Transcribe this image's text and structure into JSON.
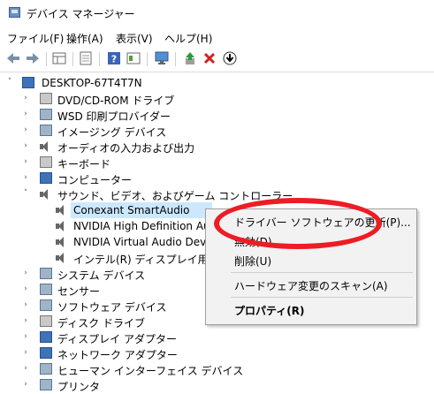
{
  "window": {
    "title": "デバイス マネージャー"
  },
  "menubar": {
    "items": [
      {
        "label": "ファイル(F)"
      },
      {
        "label": "操作(A)"
      },
      {
        "label": "表示(V)"
      },
      {
        "label": "ヘルプ(H)"
      }
    ]
  },
  "toolbar": {
    "buttons": [
      "back-icon",
      "forward-icon",
      "properties-grid-icon",
      "page-icon",
      "help-icon",
      "view-icon",
      "monitor-icon",
      "update-driver-icon",
      "uninstall-x-icon",
      "download-icon"
    ]
  },
  "tree": {
    "root": "DESKTOP-67T4T7N",
    "categories": [
      {
        "label": "DVD/CD-ROM ドライブ"
      },
      {
        "label": "WSD 印刷プロバイダー"
      },
      {
        "label": "イメージング デバイス"
      },
      {
        "label": "オーディオの入力および出力"
      },
      {
        "label": "キーボード"
      },
      {
        "label": "コンピューター"
      },
      {
        "label": "サウンド、ビデオ、およびゲーム コントローラー"
      },
      {
        "label": "システム デバイス"
      },
      {
        "label": "センサー"
      },
      {
        "label": "ソフトウェア デバイス"
      },
      {
        "label": "ディスク ドライブ"
      },
      {
        "label": "ディスプレイ アダプター"
      },
      {
        "label": "ネットワーク アダプター"
      },
      {
        "label": "ヒューマン インターフェイス デバイス"
      },
      {
        "label": "プリンタ"
      }
    ],
    "sound_children": [
      {
        "label": "Conexant SmartAudio"
      },
      {
        "label": "NVIDIA High Definition Aud"
      },
      {
        "label": "NVIDIA Virtual Audio Devic"
      },
      {
        "label": "インテル(R) ディスプレイ用オーデ"
      }
    ]
  },
  "context_menu": {
    "items": [
      {
        "label": "ドライバー ソフトウェアの更新(P)..."
      },
      {
        "label": "無効(D)"
      },
      {
        "label": "削除(U)"
      },
      {
        "label": "ハードウェア変更のスキャン(A)"
      },
      {
        "label": "プロパティ(R)"
      }
    ]
  },
  "colors": {
    "selection": "#cce8ff",
    "highlight_ellipse": "#ee1c24"
  }
}
